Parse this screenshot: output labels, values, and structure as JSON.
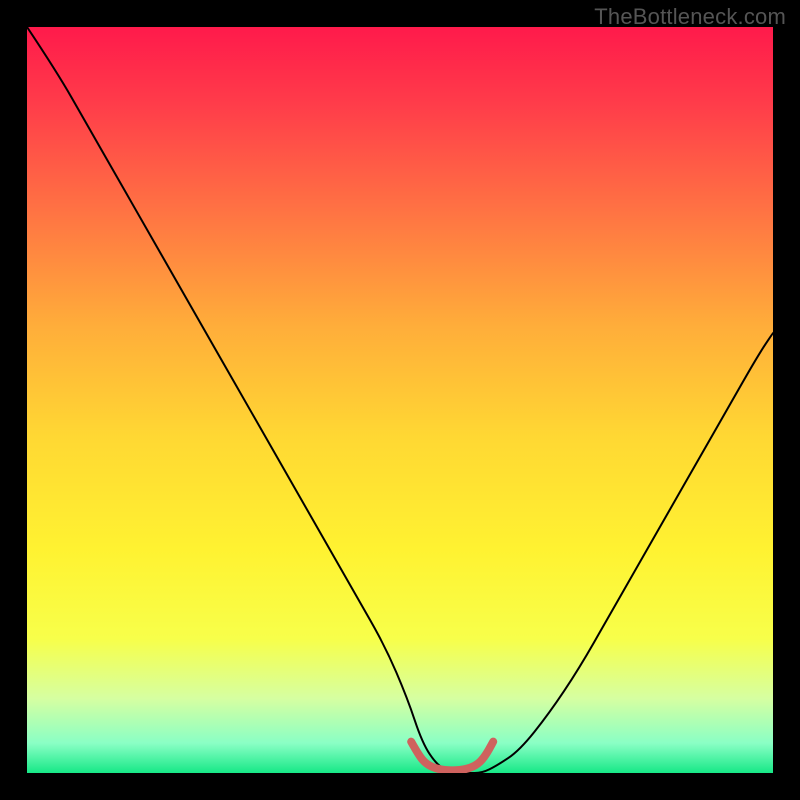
{
  "watermark": "TheBottleneck.com",
  "chart_data": {
    "type": "line",
    "title": "",
    "xlabel": "",
    "ylabel": "",
    "xlim": [
      0,
      100
    ],
    "ylim": [
      0,
      100
    ],
    "grid": false,
    "legend": false,
    "background": {
      "type": "vertical-gradient",
      "stops": [
        {
          "pos": 0.0,
          "color": "#ff1a4b"
        },
        {
          "pos": 0.1,
          "color": "#ff3b4a"
        },
        {
          "pos": 0.25,
          "color": "#ff7443"
        },
        {
          "pos": 0.4,
          "color": "#ffad3a"
        },
        {
          "pos": 0.55,
          "color": "#ffd833"
        },
        {
          "pos": 0.7,
          "color": "#fff231"
        },
        {
          "pos": 0.82,
          "color": "#f7ff4a"
        },
        {
          "pos": 0.9,
          "color": "#d6ffa1"
        },
        {
          "pos": 0.96,
          "color": "#8affc5"
        },
        {
          "pos": 1.0,
          "color": "#17e887"
        }
      ]
    },
    "series": [
      {
        "name": "bottleneck-curve",
        "stroke": "#000000",
        "stroke_width": 2,
        "x": [
          0,
          4,
          8,
          12,
          16,
          20,
          24,
          28,
          32,
          36,
          40,
          44,
          48,
          51,
          53,
          55,
          57,
          59,
          61,
          63,
          66,
          70,
          74,
          78,
          82,
          86,
          90,
          94,
          98,
          100
        ],
        "y": [
          100,
          94,
          87,
          80,
          73,
          66,
          59,
          52,
          45,
          38,
          31,
          24,
          17,
          10,
          4,
          1,
          0,
          0,
          0,
          1,
          3,
          8,
          14,
          21,
          28,
          35,
          42,
          49,
          56,
          59
        ]
      },
      {
        "name": "optimal-band",
        "stroke": "#cf625e",
        "stroke_width": 8,
        "linecap": "round",
        "x": [
          51.5,
          52.5,
          53.5,
          55.0,
          57.0,
          59.0,
          60.5,
          61.5,
          62.5
        ],
        "y": [
          4.2,
          2.4,
          1.2,
          0.5,
          0.3,
          0.5,
          1.2,
          2.4,
          4.2
        ]
      }
    ]
  }
}
